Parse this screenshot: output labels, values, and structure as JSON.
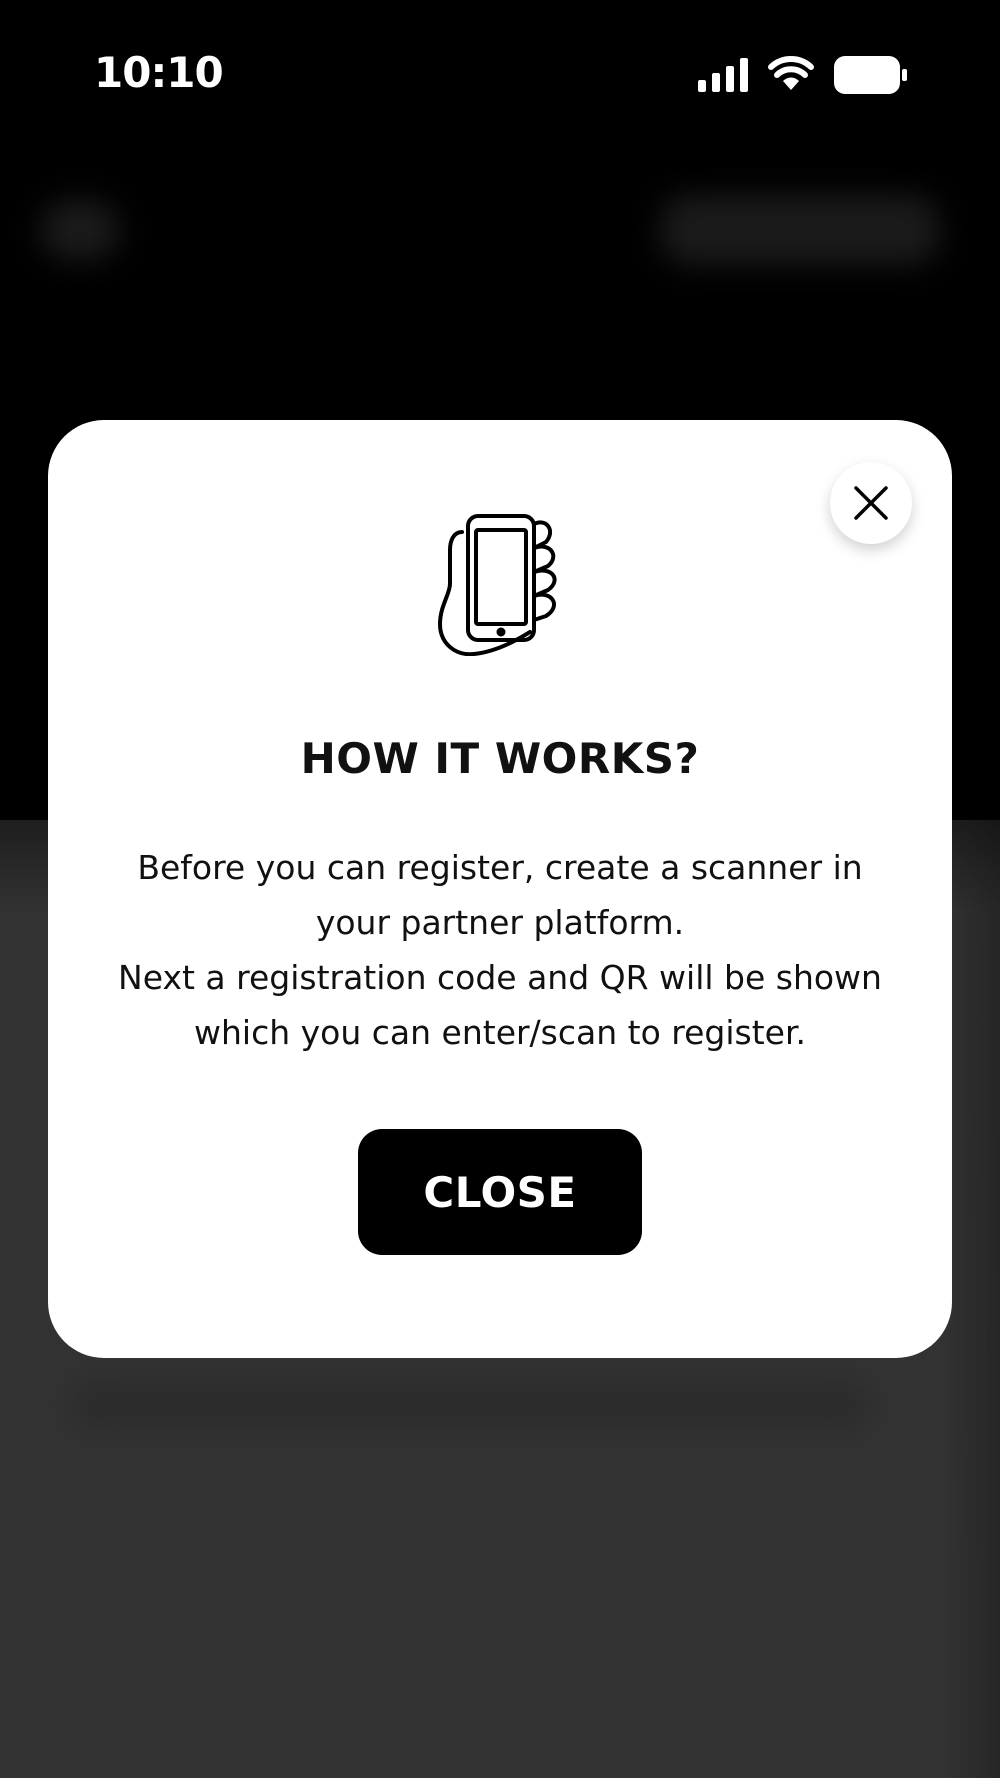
{
  "status_bar": {
    "time": "10:10",
    "icons": [
      "signal-icon",
      "wifi-icon",
      "battery-icon"
    ]
  },
  "modal": {
    "icon": "hand-holding-phone-icon",
    "title": "HOW IT WORKS?",
    "body_lines": [
      "Before you can register, create a scanner in",
      "your partner platform.",
      "Next a registration code and QR will be shown",
      "which you can enter/scan to register."
    ],
    "close_icon": "close-icon",
    "close_button_label": "CLOSE"
  },
  "colors": {
    "overlay_top": "#000000",
    "overlay_bottom": "#333333",
    "modal_bg": "#ffffff",
    "button_bg": "#000000",
    "button_text": "#ffffff"
  }
}
